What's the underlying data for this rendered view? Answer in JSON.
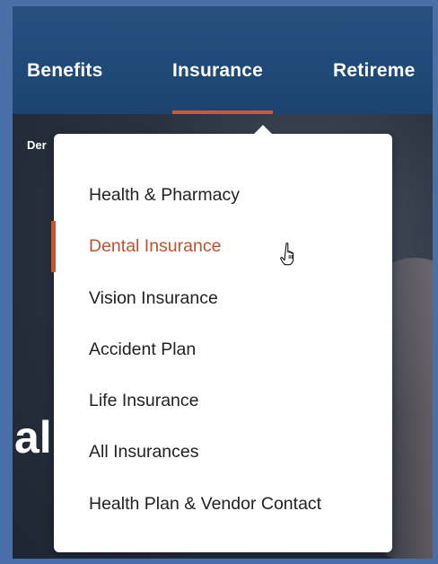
{
  "nav": {
    "items": [
      {
        "label": "Benefits"
      },
      {
        "label": "Insurance"
      },
      {
        "label": "Retireme"
      }
    ],
    "active_index": 1,
    "accent_color": "#d2562e"
  },
  "breadcrumb": {
    "visible_text": "Der"
  },
  "hero": {
    "heading_visible_text": "al"
  },
  "dropdown": {
    "items": [
      {
        "label": "Health & Pharmacy"
      },
      {
        "label": "Dental Insurance"
      },
      {
        "label": "Vision Insurance"
      },
      {
        "label": "Accident Plan"
      },
      {
        "label": "Life Insurance"
      },
      {
        "label": "All Insurances"
      },
      {
        "label": "Health Plan & Vendor Contact"
      }
    ],
    "active_index": 1,
    "active_color": "#c2512e"
  },
  "cursor": {
    "icon": "pointer-hand-icon"
  }
}
